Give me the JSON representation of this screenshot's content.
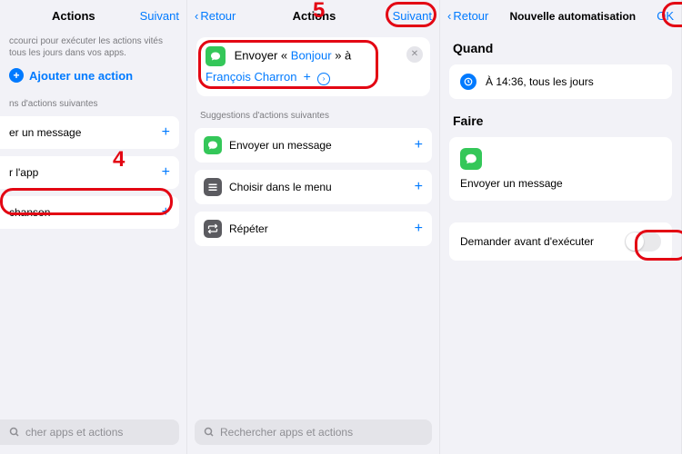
{
  "p1": {
    "title": "Actions",
    "next": "Suivant",
    "sub": "ccourci pour exécuter les actions vités tous les jours dans vos apps.",
    "add_action": "Ajouter une action",
    "sugg_label": "ns d'actions suivantes",
    "items": [
      {
        "label": "er un message"
      },
      {
        "label": "r l'app"
      },
      {
        "label": "chanson"
      }
    ],
    "search": "cher apps et actions"
  },
  "p2": {
    "back": "Retour",
    "title": "Actions",
    "next": "Suivant",
    "compose_pre": "Envoyer « ",
    "compose_token": "Bonjour",
    "compose_mid": " » à",
    "compose_recipient": "François Charron",
    "sugg_label": "Suggestions d'actions suivantes",
    "items": [
      {
        "label": "Envoyer un message"
      },
      {
        "label": "Choisir dans le menu"
      },
      {
        "label": "Répéter"
      }
    ],
    "search": "Rechercher apps et actions"
  },
  "p3": {
    "back": "Retour",
    "title": "Nouvelle automatisation",
    "ok": "OK",
    "when": "Quand",
    "when_text": "À 14:36, tous les jours",
    "do": "Faire",
    "do_text": "Envoyer un message",
    "ask": "Demander avant d'exécuter"
  },
  "annotations": {
    "n4": "4",
    "n5": "5"
  }
}
